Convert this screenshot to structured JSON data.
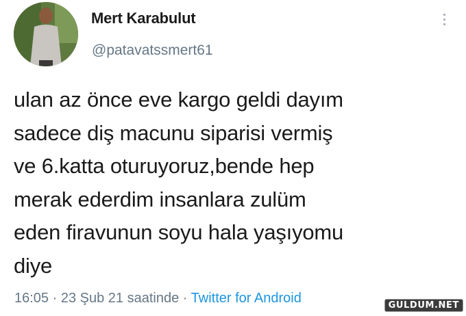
{
  "user": {
    "display_name": "Mert Karabulut",
    "handle": "@patavatssmert61",
    "avatar_icon": "profile-photo"
  },
  "tweet": {
    "lines": [
      "ulan az önce eve kargo geldi dayım",
      "sadece diş macunu siparisi vermiş",
      "ve 6.katta oturuyoruz,bende hep",
      "merak ederdim insanlara zulüm",
      "eden firavunun soyu hala yaşıyomu",
      "diye"
    ]
  },
  "meta": {
    "time": "16:05",
    "date": "23 Şub 21 saatinde",
    "separator": "·",
    "source": "Twitter for Android"
  },
  "menu_icon": "more-vertical-icon",
  "watermark": "GULDUM.NET",
  "colors": {
    "text": "#14171a",
    "secondary": "#657786",
    "link": "#1b95e0"
  }
}
